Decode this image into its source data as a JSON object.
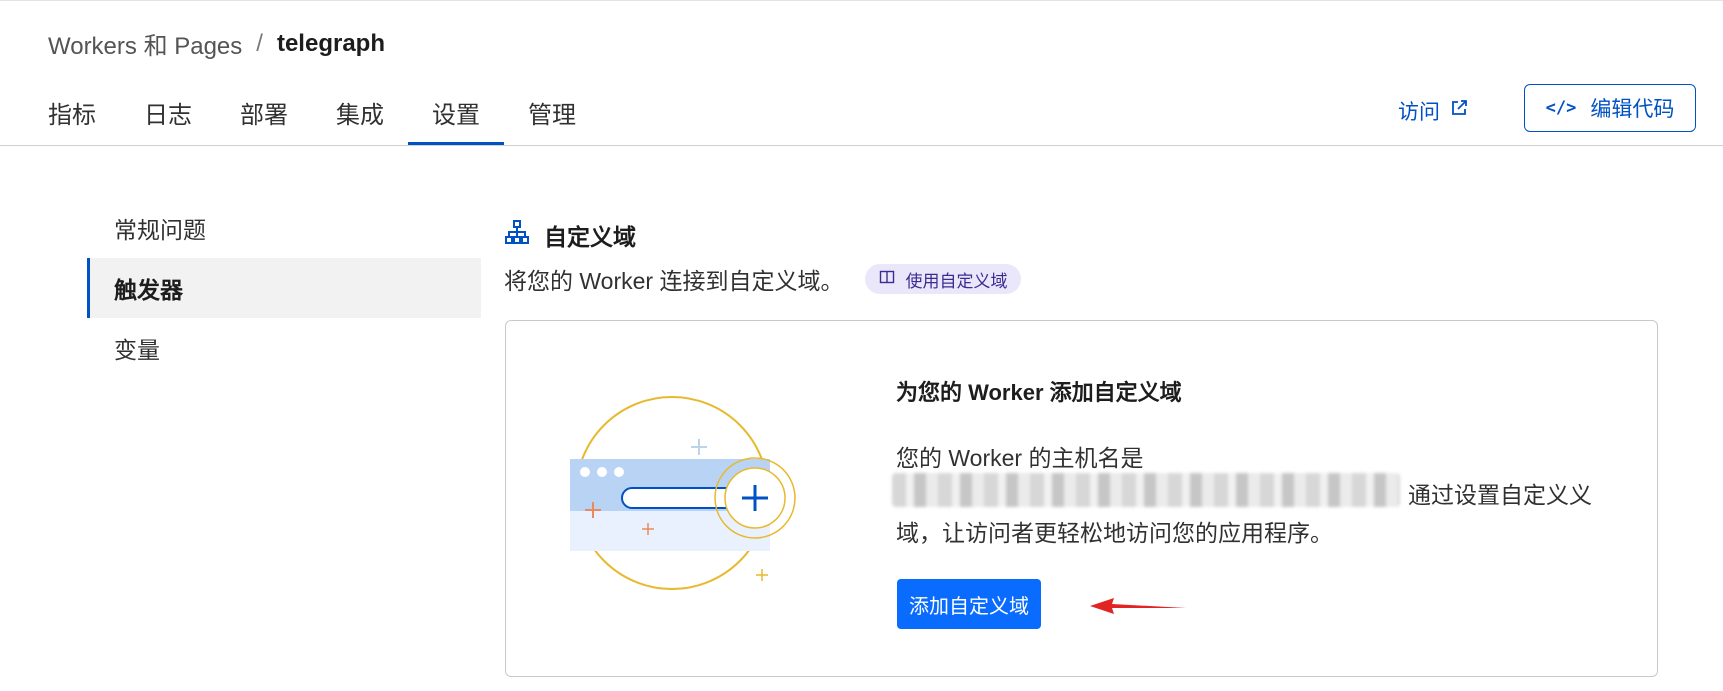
{
  "breadcrumb": {
    "parent": "Workers 和 Pages",
    "separator": "/",
    "current": "telegraph"
  },
  "tabs": [
    {
      "label": "指标",
      "active": false
    },
    {
      "label": "日志",
      "active": false
    },
    {
      "label": "部署",
      "active": false
    },
    {
      "label": "集成",
      "active": false
    },
    {
      "label": "设置",
      "active": true
    },
    {
      "label": "管理",
      "active": false
    }
  ],
  "header_actions": {
    "visit_label": "访问",
    "edit_code_label": "编辑代码"
  },
  "sidebar": {
    "items": [
      {
        "label": "常规问题",
        "active": false
      },
      {
        "label": "触发器",
        "active": true
      },
      {
        "label": "变量",
        "active": false
      }
    ]
  },
  "section": {
    "title": "自定义域",
    "description": "将您的 Worker 连接到自定义域。",
    "doc_link_label": "使用自定义域"
  },
  "card": {
    "title": "为您的 Worker 添加自定义域",
    "text_line1": "您的 Worker 的主机名是",
    "text_line2_tail": "通过设置自定义义",
    "text_line3": "域，让访问者更轻松地访问您的应用程序。",
    "add_button_label": "添加自定义域"
  },
  "colors": {
    "accent": "#0051c3",
    "primary_button": "#0a6cff",
    "annotation_arrow": "#e32424",
    "illustration_ring": "#e8b92e"
  }
}
